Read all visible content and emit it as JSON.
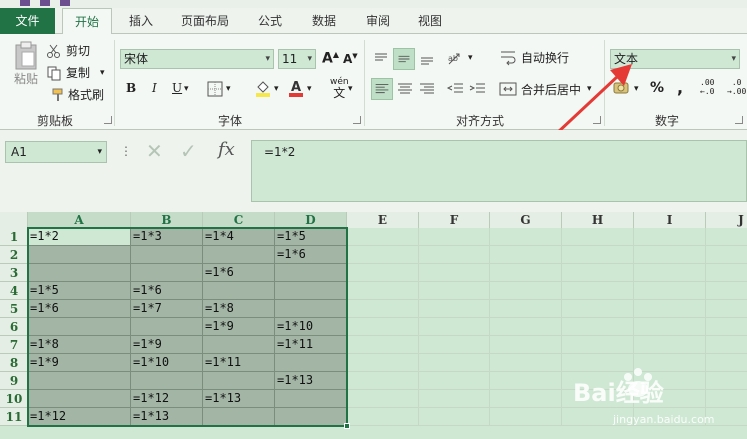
{
  "window": {
    "title": "文本"
  },
  "tabs": [
    "文件",
    "开始",
    "插入",
    "页面布局",
    "公式",
    "数据",
    "审阅",
    "视图"
  ],
  "ribbon": {
    "clipboard": {
      "label": "剪贴板",
      "paste": "粘贴",
      "cut": "剪切",
      "copy": "复制",
      "format_painter": "格式刷"
    },
    "font": {
      "label": "字体",
      "font_name": "宋体",
      "font_size": "11",
      "bold": "B",
      "italic": "I",
      "underline": "U",
      "phonetic": "wén"
    },
    "alignment": {
      "label": "对齐方式",
      "wrap_text": "自动换行",
      "merge_center": "合并后居中"
    },
    "number": {
      "label": "数字",
      "format": "文本",
      "percent": "%",
      "comma": ",",
      "dec_increase": ".00",
      "dec_decrease": ".0"
    }
  },
  "formula_bar": {
    "name_box": "A1",
    "fx": "fx",
    "content": "=1*2"
  },
  "grid": {
    "columns": [
      "A",
      "B",
      "C",
      "D",
      "E",
      "F",
      "G",
      "H",
      "I",
      "J"
    ],
    "rows": [
      "1",
      "2",
      "3",
      "4",
      "5",
      "6",
      "7",
      "8",
      "9",
      "10",
      "11"
    ],
    "cells": [
      [
        "=1*2",
        "=1*3",
        "=1*4",
        "=1*5"
      ],
      [
        "",
        "",
        "",
        "=1*6"
      ],
      [
        "",
        "",
        "=1*6",
        ""
      ],
      [
        "=1*5",
        "=1*6",
        "",
        ""
      ],
      [
        "=1*6",
        "=1*7",
        "=1*8",
        ""
      ],
      [
        "",
        "",
        "=1*9",
        "=1*10"
      ],
      [
        "=1*8",
        "=1*9",
        "",
        "=1*11"
      ],
      [
        "=1*9",
        "=1*10",
        "=1*11",
        ""
      ],
      [
        "",
        "",
        "",
        "=1*13"
      ],
      [
        "",
        "=1*12",
        "=1*13",
        ""
      ],
      [
        "=1*12",
        "=1*13",
        "",
        ""
      ]
    ]
  },
  "watermark": {
    "brand": "Bai经验",
    "url": "jingyan.baidu.com"
  },
  "colors": {
    "accent": "#217346",
    "arrow": "#e53935",
    "selection": "#a3b5a5",
    "background": "#cfe8d4"
  }
}
